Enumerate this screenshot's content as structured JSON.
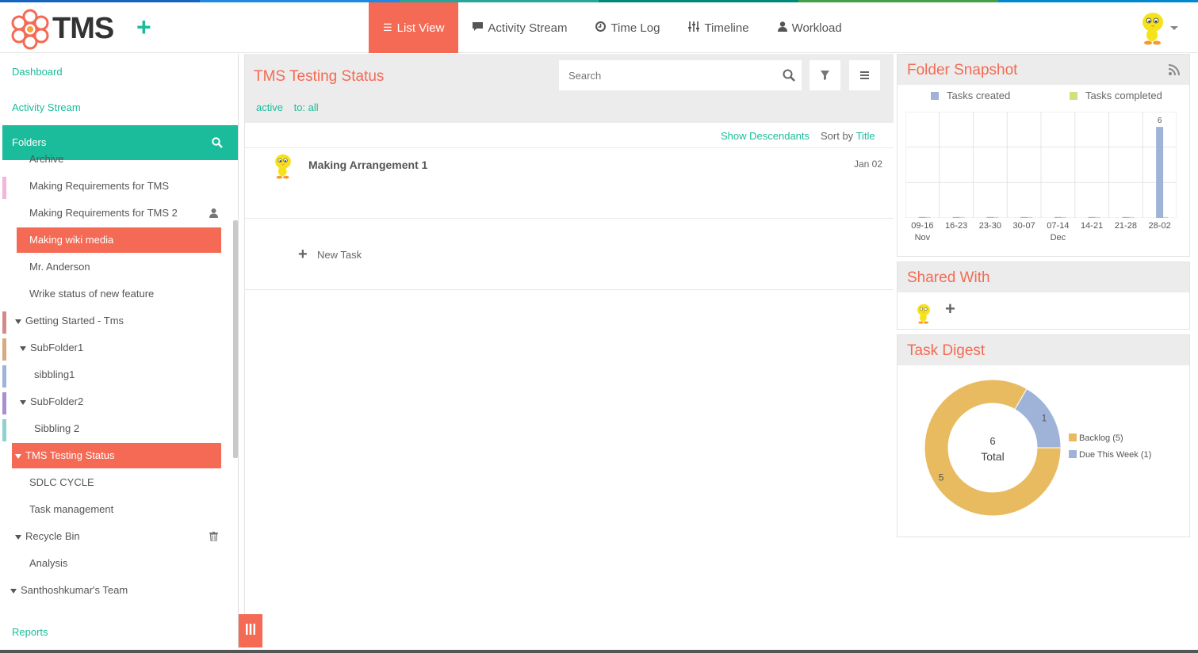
{
  "colors": {
    "accent": "#f46a54",
    "brand": "#1abc9c",
    "stripe": [
      "#1565c0",
      "#1e88e5",
      "#26a69a",
      "#00897b",
      "#43a047",
      "#0288d1"
    ]
  },
  "header": {
    "logo_text": "TMS",
    "nav": [
      {
        "label": "List View",
        "icon": "list-icon",
        "active": true
      },
      {
        "label": "Activity Stream",
        "icon": "comment-icon",
        "active": false
      },
      {
        "label": "Time Log",
        "icon": "clock-icon",
        "active": false
      },
      {
        "label": "Timeline",
        "icon": "sliders-icon",
        "active": false
      },
      {
        "label": "Workload",
        "icon": "user-icon",
        "active": false
      }
    ]
  },
  "sidebar": {
    "dashboard": "Dashboard",
    "activity_stream": "Activity Stream",
    "folders_label": "Folders",
    "reports": "Reports",
    "tree": [
      {
        "label": "Archive",
        "indent": 1,
        "top": -23,
        "stripe": null,
        "arrow": false,
        "selected": false
      },
      {
        "label": "Making Requirements for TMS",
        "indent": 1,
        "stripe": "#f4b6d8",
        "arrow": false,
        "selected": false
      },
      {
        "label": "Making Requirements for TMS 2",
        "indent": 1,
        "stripe": null,
        "arrow": false,
        "selected": false,
        "icon": "person-icon"
      },
      {
        "label": "Making wiki media",
        "indent": 1,
        "stripe": null,
        "arrow": false,
        "selected": true,
        "narrow": true
      },
      {
        "label": "Mr. Anderson",
        "indent": 1,
        "stripe": null,
        "arrow": false,
        "selected": false
      },
      {
        "label": "Wrike status of new feature",
        "indent": 1,
        "stripe": null,
        "arrow": false,
        "selected": false
      },
      {
        "label": "Getting Started - Tms",
        "indent": 0,
        "stripe": "#d48a8a",
        "arrow": true,
        "selected": false
      },
      {
        "label": "SubFolder1",
        "indent": 1,
        "stripe": "#d9a97f",
        "arrow": true,
        "selected": false
      },
      {
        "label": "sibbling1",
        "indent": 2,
        "stripe": "#9fb3d9",
        "arrow": false,
        "selected": false
      },
      {
        "label": "SubFolder2",
        "indent": 1,
        "stripe": "#a98fcf",
        "arrow": true,
        "selected": false
      },
      {
        "label": "Sibbling 2",
        "indent": 2,
        "stripe": "#8fd0d0",
        "arrow": false,
        "selected": false
      },
      {
        "label": "TMS Testing Status",
        "indent": 0,
        "stripe": null,
        "arrow": true,
        "selected": true
      },
      {
        "label": "SDLC CYCLE",
        "indent": 1,
        "stripe": null,
        "arrow": false,
        "selected": false
      },
      {
        "label": "Task management",
        "indent": 1,
        "stripe": null,
        "arrow": false,
        "selected": false
      },
      {
        "label": "Recycle Bin",
        "indent": 0,
        "stripe": null,
        "arrow": true,
        "selected": false,
        "icon": "trash-icon"
      },
      {
        "label": "Analysis",
        "indent": 1,
        "stripe": null,
        "arrow": false,
        "selected": false
      },
      {
        "label": "Santhoshkumar's Team",
        "indent": -1,
        "stripe": null,
        "arrow": true,
        "selected": false
      }
    ]
  },
  "main": {
    "title": "TMS Testing Status",
    "search_placeholder": "Search",
    "filters": [
      "active",
      "to: all"
    ],
    "show_descendants": "Show Descendants",
    "sort_by_label": "Sort by",
    "sort_by_value": "Title",
    "task": {
      "title": "Making Arrangement 1",
      "date": "Jan 02"
    },
    "new_task": "New Task"
  },
  "right": {
    "snapshot_title": "Folder Snapshot",
    "shared_title": "Shared With",
    "digest_title": "Task Digest"
  },
  "chart_data": [
    {
      "type": "bar",
      "title": "Folder Snapshot",
      "categories": [
        "09-16",
        "16-23",
        "23-30",
        "30-07",
        "07-14",
        "14-21",
        "21-28",
        "28-02"
      ],
      "month_labels": {
        "09-16": "Nov",
        "07-14": "Dec"
      },
      "series": [
        {
          "name": "Tasks created",
          "color": "#9fb3d9",
          "values": [
            0,
            0,
            0,
            0,
            0,
            0,
            0,
            6
          ]
        },
        {
          "name": "Tasks completed",
          "color": "#cfe07f",
          "values": [
            0,
            0,
            0,
            0,
            0,
            0,
            0,
            0
          ]
        }
      ],
      "data_labels": [
        null,
        null,
        null,
        null,
        null,
        null,
        null,
        "6"
      ],
      "ylim": [
        0,
        7
      ],
      "grid": true,
      "legend": "top"
    },
    {
      "type": "pie",
      "title": "Task Digest",
      "center_value": "6",
      "center_label": "Total",
      "slices": [
        {
          "name": "Backlog (5)",
          "value": 5,
          "label": "5",
          "color": "#e8bb60"
        },
        {
          "name": "Due This Week (1)",
          "value": 1,
          "label": "1",
          "color": "#9fb3d9"
        }
      ],
      "legend": "right"
    }
  ]
}
